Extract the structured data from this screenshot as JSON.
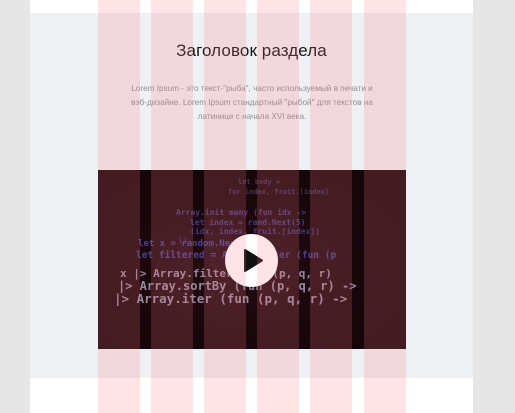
{
  "section": {
    "title": "Заголовок раздела",
    "text": "Lorem Ipsum - это текст-\"рыба\", часто используемый в печати и\nвэб-дизайне. Lorem Ipsum   стандартный \"рыбой\" для текстов на\nлатинице с начала XVI века."
  },
  "video": {
    "play_icon": "play-icon",
    "code_lines": [
      "Array.init many (fun idx ->",
      "let index = rand.Next(5)",
      "(idx, index, fruit.[index])",
      "))",
      "let x = random.Next 10",
      "let filtered = Array.filter (fun (p",
      "x |> Array.filter (fun (p, q, r)",
      "|> Array.sortBy (fun (p, q, r) ->",
      "|> Array.iter (fun (p, q, r) ->"
    ]
  },
  "colors": {
    "page_bg": "#e6e6e6",
    "section_bg": "#eef0f3",
    "grid_overlay": "#ff7887",
    "video_bg": "#0d0608",
    "code_keyword": "#6a6cf0",
    "code_text": "#d9d9f2"
  }
}
